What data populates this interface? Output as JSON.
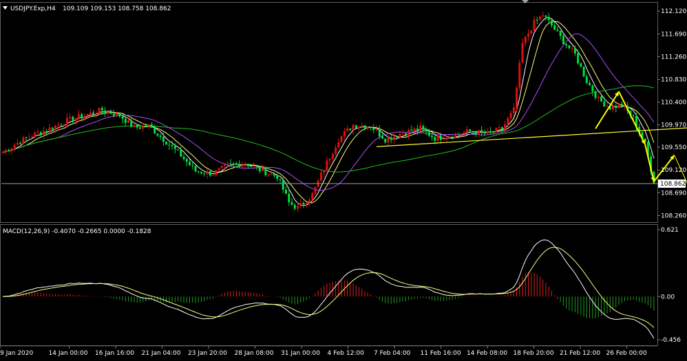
{
  "chart_data": [
    {
      "type": "candlestick",
      "title": "USDJPY.Exp,H4",
      "ohlc_header": "109.109 109.153 108.758 108.862",
      "ylim": [
        108.2,
        112.2
      ],
      "y_ticks": [
        "112.120",
        "111.690",
        "111.260",
        "110.830",
        "110.400",
        "109.970",
        "109.550",
        "109.120",
        "108.690",
        "108.260"
      ],
      "y_tick_values": [
        112.12,
        111.69,
        111.26,
        110.83,
        110.4,
        109.97,
        109.55,
        109.12,
        108.69,
        108.26
      ],
      "current_price": "108.862",
      "current_price_value": 108.862,
      "x_ticks": [
        "9 Jan 2020",
        "14 Jan 00:00",
        "16 Jan 16:00",
        "21 Jan 04:00",
        "23 Jan 20:00",
        "28 Jan 08:00",
        "31 Jan 00:00",
        "4 Feb 12:00",
        "7 Feb 04:00",
        "11 Feb 16:00",
        "14 Feb 08:00",
        "18 Feb 20:00",
        "21 Feb 12:00",
        "26 Feb 00:00"
      ],
      "anchors": [
        {
          "i": 0,
          "v": 109.45
        },
        {
          "i": 4,
          "v": 109.6
        },
        {
          "i": 9,
          "v": 109.75
        },
        {
          "i": 16,
          "v": 109.9
        },
        {
          "i": 22,
          "v": 110.05
        },
        {
          "i": 28,
          "v": 110.15
        },
        {
          "i": 34,
          "v": 110.25
        },
        {
          "i": 40,
          "v": 110.15
        },
        {
          "i": 45,
          "v": 109.92
        },
        {
          "i": 50,
          "v": 109.95
        },
        {
          "i": 55,
          "v": 109.7
        },
        {
          "i": 60,
          "v": 109.45
        },
        {
          "i": 66,
          "v": 109.1
        },
        {
          "i": 72,
          "v": 109.05
        },
        {
          "i": 77,
          "v": 109.2
        },
        {
          "i": 83,
          "v": 109.25
        },
        {
          "i": 89,
          "v": 109.1
        },
        {
          "i": 94,
          "v": 109.0
        },
        {
          "i": 98,
          "v": 108.5
        },
        {
          "i": 101,
          "v": 108.4
        },
        {
          "i": 106,
          "v": 108.65
        },
        {
          "i": 110,
          "v": 109.15
        },
        {
          "i": 115,
          "v": 109.7
        },
        {
          "i": 120,
          "v": 109.97
        },
        {
          "i": 126,
          "v": 109.95
        },
        {
          "i": 131,
          "v": 109.7
        },
        {
          "i": 137,
          "v": 109.82
        },
        {
          "i": 143,
          "v": 109.9
        },
        {
          "i": 148,
          "v": 109.72
        },
        {
          "i": 154,
          "v": 109.78
        },
        {
          "i": 160,
          "v": 109.85
        },
        {
          "i": 166,
          "v": 109.8
        },
        {
          "i": 171,
          "v": 109.9
        },
        {
          "i": 175,
          "v": 110.25
        },
        {
          "i": 178,
          "v": 111.5
        },
        {
          "i": 182,
          "v": 111.9
        },
        {
          "i": 185,
          "v": 112.05
        },
        {
          "i": 188,
          "v": 111.85
        },
        {
          "i": 192,
          "v": 111.55
        },
        {
          "i": 196,
          "v": 111.3
        },
        {
          "i": 200,
          "v": 110.8
        },
        {
          "i": 204,
          "v": 110.45
        },
        {
          "i": 208,
          "v": 110.3
        },
        {
          "i": 212,
          "v": 110.35
        },
        {
          "i": 216,
          "v": 110.1
        },
        {
          "i": 220,
          "v": 109.6
        },
        {
          "i": 223,
          "v": 108.9
        }
      ],
      "n_bars": 224,
      "bar_colors": {
        "up": "#e01010",
        "down": "#00e040"
      },
      "ma_series": [
        {
          "period": 5,
          "color": "#ffffff"
        },
        {
          "period": 9,
          "color": "#ffff80"
        },
        {
          "period": 20,
          "color": "#b050ff"
        },
        {
          "period": 60,
          "color": "#20c020"
        }
      ],
      "drawings": {
        "trendline": {
          "from": [
            128,
            109.56
          ],
          "to": [
            236,
            109.92
          ],
          "color": "#ffff30"
        },
        "hline_color": "#a0a0b0",
        "arrows_color": "#ffff00",
        "arrow_path": [
          [
            203,
            109.9
          ],
          [
            211,
            110.6
          ],
          [
            220,
            109.6
          ],
          [
            223,
            108.9
          ],
          [
            230,
            109.4
          ],
          [
            240,
            108.2
          ]
        ]
      }
    },
    {
      "type": "macd",
      "label": "MACD(12,26,9) -0.4070 -0.2665 0.0000 -0.1828",
      "ylim": [
        -0.5,
        0.65
      ],
      "y_ticks": [
        "0.621",
        "0.00",
        "-0.456"
      ],
      "y_tick_values": [
        0.621,
        0.0,
        -0.456
      ],
      "hist_up_color": "#e02020",
      "hist_down_color": "#20a020",
      "macd_color": "#ffffff",
      "signal_color": "#ffff80"
    }
  ]
}
